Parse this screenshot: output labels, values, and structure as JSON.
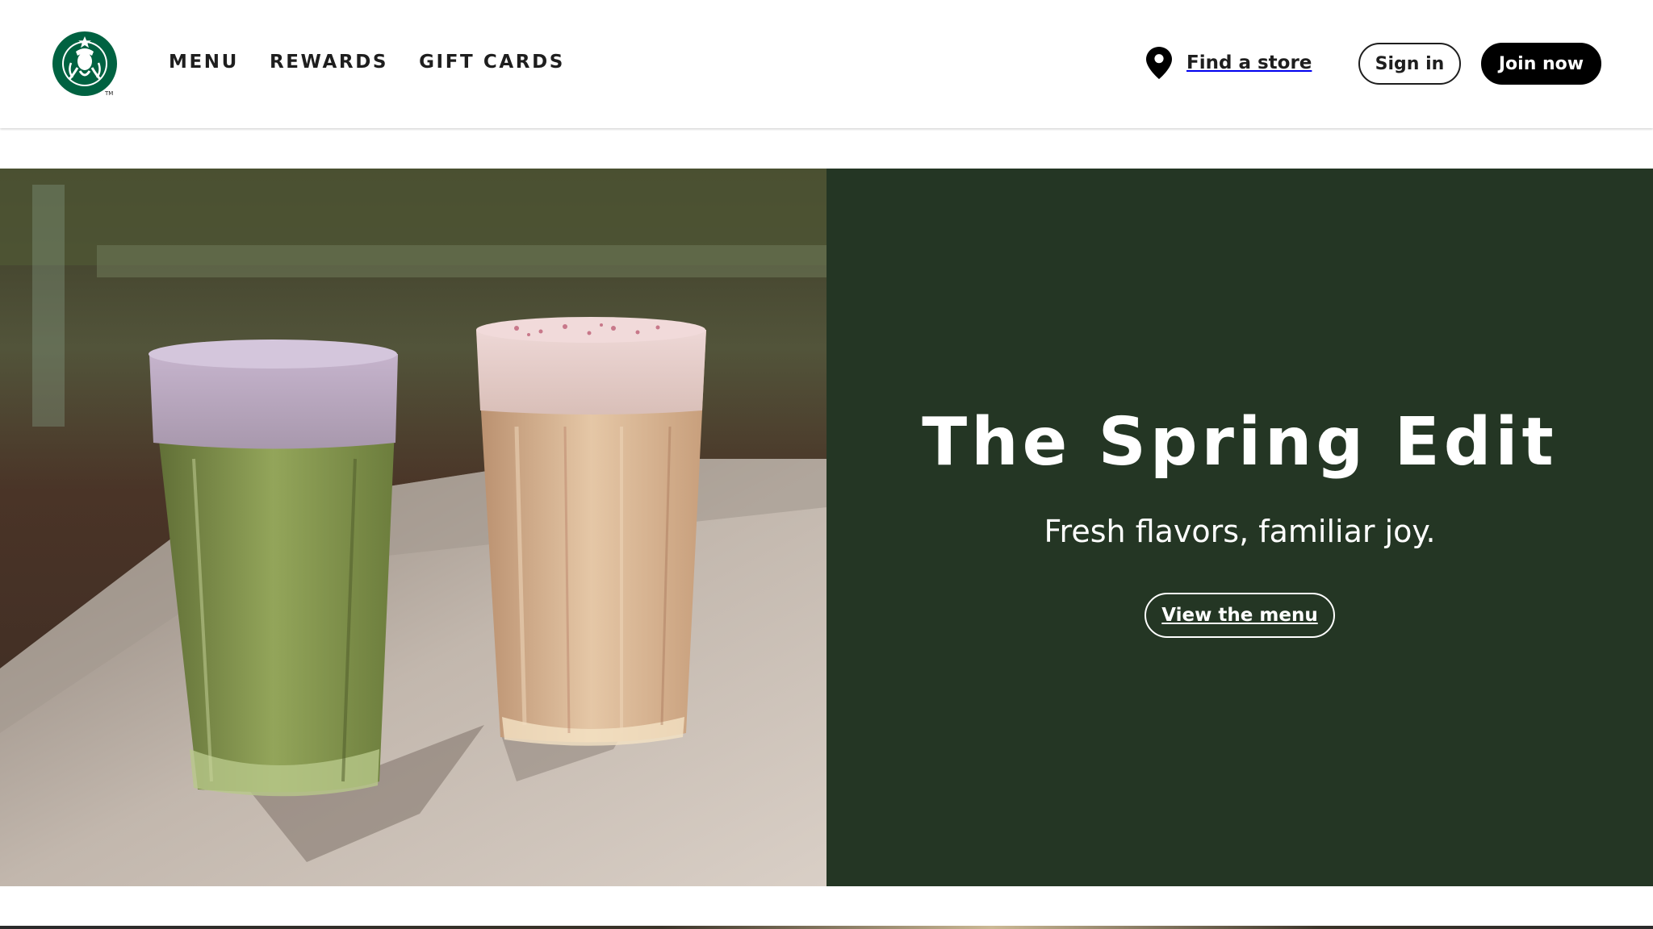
{
  "header": {
    "logo_alt": "Starbucks",
    "nav": [
      {
        "label": "MENU"
      },
      {
        "label": "REWARDS"
      },
      {
        "label": "GIFT CARDS"
      }
    ],
    "find_store_label": "Find a store",
    "signin_label": "Sign in",
    "join_label": "Join now"
  },
  "hero": {
    "title": "The Spring Edit",
    "subtitle": "Fresh flavors, familiar joy.",
    "cta_label": "View the menu",
    "panel_color": "#243624"
  },
  "colors": {
    "brand_green": "#006241",
    "text_dark": "#1e1e1e",
    "black": "#000000"
  }
}
